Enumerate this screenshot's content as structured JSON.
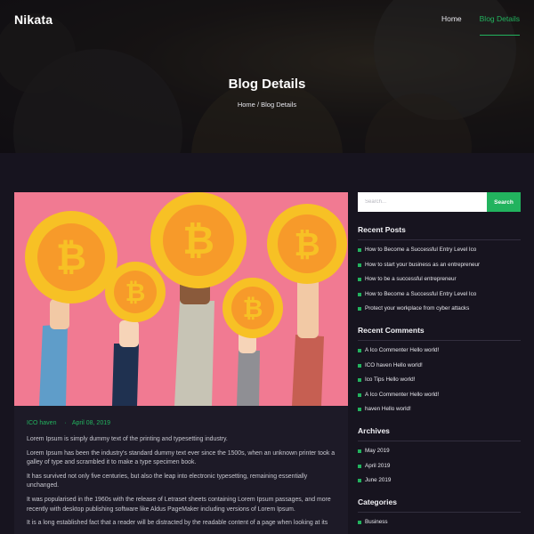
{
  "brand": {
    "logo": "Nikata"
  },
  "nav": {
    "items": [
      {
        "label": "Home"
      },
      {
        "label": "Blog Details"
      }
    ]
  },
  "hero": {
    "title": "Blog Details",
    "breadcrumb": {
      "home": "Home",
      "separator": " / ",
      "current": "Blog Details"
    }
  },
  "post": {
    "category": "ICO haven",
    "date": "April 08, 2019",
    "paragraphs": [
      "Lorem Ipsum is simply dummy text of the printing and typesetting industry.",
      "Lorem Ipsum has been the industry's standard dummy text ever since the 1500s, when an unknown printer took a galley of type and scrambled it to make a type specimen book.",
      "It has survived not only five centuries, but also the leap into electronic typesetting, remaining essentially unchanged.",
      "It was popularised in the 1960s with the release of Letraset sheets containing Lorem Ipsum passages, and more recently with desktop publishing software like Aldus PageMaker including versions of Lorem Ipsum.",
      "It is a long established fact that a reader will be distracted by the readable content of a page when looking at its"
    ]
  },
  "sidebar": {
    "search": {
      "placeholder": "Search...",
      "button": "Search"
    },
    "recent_posts": {
      "title": "Recent Posts",
      "items": [
        "How to Become a Successful Entry Level Ico",
        "How to start your business as an entrepreneur",
        "How to be a successful entrepreneur",
        "How to Become a Successful Entry Level Ico",
        "Protect your workplace from cyber attacks"
      ]
    },
    "recent_comments": {
      "title": "Recent Comments",
      "items": [
        "A Ico Commenter Hello world!",
        "ICO haven Hello world!",
        "Ico Tips Hello world!",
        "A Ico Commenter Hello world!",
        "haven Hello world!"
      ]
    },
    "archives": {
      "title": "Archives",
      "items": [
        "May 2019",
        "April 2019",
        "June 2019"
      ]
    },
    "categories": {
      "title": "Categories",
      "items": [
        "Business"
      ]
    }
  },
  "colors": {
    "accent": "#22b35e",
    "page_bg": "#17141f",
    "card_bg": "#1d1a27",
    "image_bg": "#f17a92",
    "coin": "#f7c125",
    "coin_inner": "#f79a2a"
  },
  "icons": [
    "bitcoin-icon",
    "square-bullet-icon"
  ]
}
